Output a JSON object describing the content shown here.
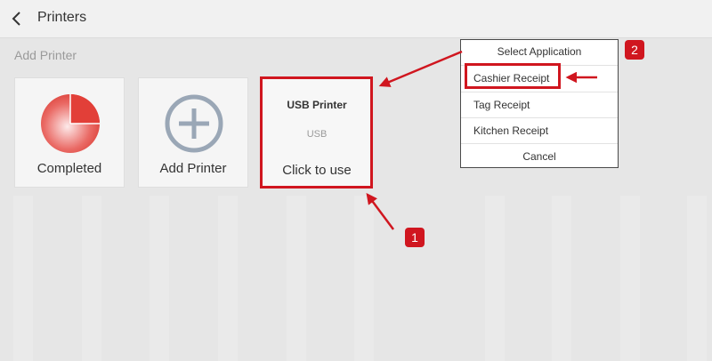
{
  "header": {
    "title": "Printers",
    "back_icon": "chevron-left-icon"
  },
  "section": {
    "label": "Add Printer"
  },
  "cards": {
    "completed": {
      "label": "Completed",
      "icon": "pie-progress-icon",
      "icon_color": "#e0443e"
    },
    "add": {
      "label": "Add Printer",
      "icon": "add-circle-icon",
      "icon_color": "#9aa7b6"
    },
    "usb": {
      "name": "USB Printer",
      "type": "USB",
      "action": "Click to use"
    }
  },
  "menu": {
    "title": "Select Application",
    "items": [
      "Cashier Receipt",
      "Tag Receipt",
      "Kitchen Receipt"
    ],
    "cancel": "Cancel"
  },
  "annotations": {
    "badge_1": "1",
    "badge_2": "2",
    "highlight_color": "#d0161f"
  }
}
